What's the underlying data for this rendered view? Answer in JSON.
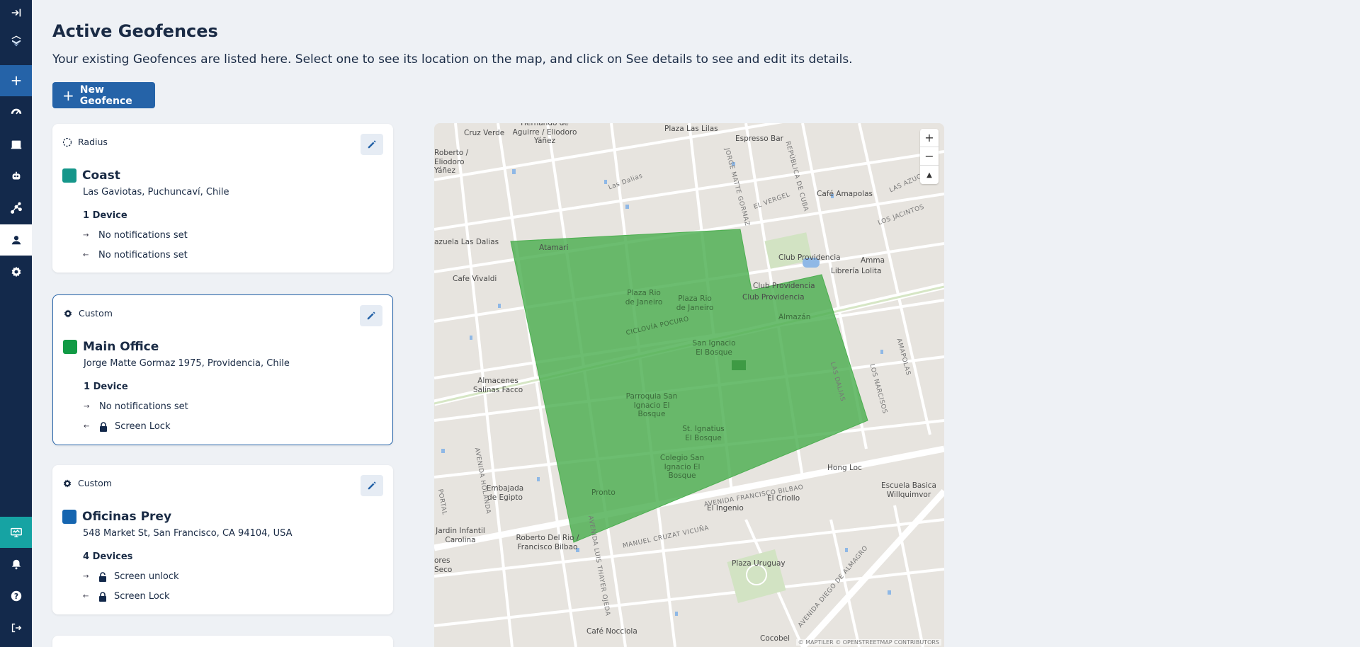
{
  "header": {
    "title": "Active Geofences",
    "description": "Your existing Geofences are listed here. Select one to see its location on the map, and click on See details to see and edit its details.",
    "new_button": "New Geofence"
  },
  "sidebar": {
    "items": [
      "collapse-icon",
      "logo-icon",
      "plus-icon",
      "dashboard-icon",
      "book-icon",
      "robot-icon",
      "flow-icon",
      "user-pin-icon",
      "gear-icon",
      "monitor-icon",
      "bell-icon",
      "help-icon",
      "logout-icon"
    ],
    "accent": "#2563a8",
    "background": "#13294b"
  },
  "geofences": [
    {
      "type": "Radius",
      "name": "Coast",
      "color": "#15968a",
      "address": "Las Gaviotas, Puchuncaví, Chile",
      "devices": "1 Device",
      "enter": "No notifications set",
      "exit": "No notifications set"
    },
    {
      "type": "Custom",
      "name": "Main Office",
      "color": "#119a45",
      "address": "Jorge Matte Gormaz 1975, Providencia, Chile",
      "devices": "1 Device",
      "enter": "No notifications set",
      "exit": "Screen Lock"
    },
    {
      "type": "Custom",
      "name": "Oficinas Prey",
      "color": "#1565b0",
      "address": "548 Market St, San Francisco, CA 94104, USA",
      "devices": "4 Devices",
      "enter": "Screen unlock",
      "exit": "Screen Lock"
    }
  ],
  "map": {
    "labels": {
      "cruz_verde": "Cruz Verde",
      "hernando": "Hernando de Aguirre / Eliodoro Yáñez",
      "plaza_lilas": "Plaza Las Lilas",
      "espresso": "Espresso Bar",
      "roberto": "Roberto / Eliodoro Yáñez",
      "cafe_amapolas": "Café Amapolas",
      "las_dalias": "Las Dalias",
      "azuela": "azuela Las Dalias",
      "atamari": "Atamari",
      "club_prov1": "Club Providencia",
      "club_prov2": "Club Providencia",
      "club_prov3": "Club Providencia",
      "amma": "Amma",
      "libreria": "Librería Lolita",
      "cafe_vivaldi": "Cafe Vivaldi",
      "plaza_rio1": "Plaza Rio de Janeiro",
      "plaza_rio2": "Plaza Rio de Janeiro",
      "almazan": "Almazán",
      "san_ignacio": "San Ignacio El Bosque",
      "almacenes": "Almacenes Salinas Facco",
      "parroquia": "Parroquia San Ignacio El Bosque",
      "st_ignatius": "St. Ignatius El Bosque",
      "colegio": "Colegio San Ignacio El Bosque",
      "hong_loc": "Hong Loc",
      "embajada": "Embajada de Egipto",
      "pronto": "Pronto",
      "escuela": "Escuela Basica Willquimvor",
      "el_criollo": "El Criollo",
      "el_ingenio": "El Ingenio",
      "jardin": "Jardin Infantil Carolina",
      "roberto_rio": "Roberto Del Rio / Francisco Bilbao",
      "plaza_uruguay": "Plaza Uruguay",
      "cafe_nocciola": "Café Nocciola",
      "cocobel": "Cocobel",
      "ores": "ores Seco",
      "av_fbilbao": "AVENIDA FRANCISCO BILBAO",
      "manuel_cruzat": "MANUEL CRUZAT VICUÑA",
      "av_holanda": "AVENIDA HOLANDA",
      "av_luis_thayer": "AVENIDA LUIS THAYER OJEDA",
      "jorge_matte": "JORGE MATTE GORMAZ",
      "republica": "REPÚBLICA DE CUBA",
      "el_vergel": "EL VERGEL",
      "las_azucenas": "LAS AZUCENAS",
      "los_jacintos": "LOS JACINTOS",
      "amapolas": "AMAPOLAS",
      "los_narcisos": "LOS NARCISOS",
      "las_dalias_st": "LAS DALIAS",
      "ciclovia": "CICLOVÍA POCURO",
      "av_diego": "AVENIDA DIEGO DE ALMAGRO",
      "portal": "PORTAL",
      "las_dalias2": "LAS DALIAS"
    },
    "attribution": "© MAPTILER © OPENSTREETMAP CONTRIBUTORS",
    "zoom_in": "+",
    "zoom_out": "−",
    "compass": "▲",
    "geofence_fill": "#4caf50"
  }
}
